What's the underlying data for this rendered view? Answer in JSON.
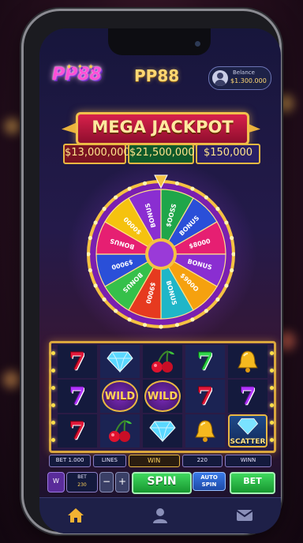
{
  "app": {
    "logo_text": "PP88",
    "title": "PP88",
    "balance_label": "Belance",
    "balance_value": "$1.300.000"
  },
  "jackpot": {
    "banner": "MEGA JACKPOT",
    "prizes": [
      "$13,000,000",
      "$21,500,000",
      "$150,000"
    ]
  },
  "wheel": {
    "segments": [
      "$OOSS",
      "BONUS",
      "$8000",
      "BONUS",
      "$900O",
      "BONUS",
      "$9000",
      "BONUS",
      "$9000",
      "BONUS",
      "$0000",
      "BONUS"
    ],
    "colors": [
      "#1fa64a",
      "#2a4fd8",
      "#e61f72",
      "#8a2ed1",
      "#f5a10f",
      "#1fb6c8",
      "#e63a1f",
      "#35c04a",
      "#2a4fd8",
      "#e61f72",
      "#f5c20f",
      "#8a2ed1"
    ]
  },
  "reels": {
    "rows": [
      [
        "seven-red",
        "diamond",
        "cherry",
        "seven-green",
        "bell"
      ],
      [
        "seven-purple",
        "wild",
        "wild",
        "seven-red",
        "seven-purple"
      ],
      [
        "seven-red",
        "cherry",
        "diamond",
        "bell",
        "scatter"
      ]
    ],
    "wild_label": "WILD",
    "scatter_label": "SCATTER"
  },
  "info": {
    "bet": "BET 1.000",
    "lines": "LINES",
    "win": "WIN",
    "lines_value": "220",
    "win_value": "WINN"
  },
  "controls": {
    "menu": "W",
    "bet_label": "BET",
    "bet_value": "230",
    "minus": "−",
    "plus": "+",
    "spin": "SPIN",
    "auto_spin_line1": "AUTO",
    "auto_spin_line2": "SPIN",
    "bet_button": "BET"
  },
  "nav": {
    "items": [
      "home-icon",
      "user-icon",
      "mail-icon"
    ]
  },
  "colors": {
    "gold": "#e9b842",
    "nav_active": "#f2b233"
  }
}
